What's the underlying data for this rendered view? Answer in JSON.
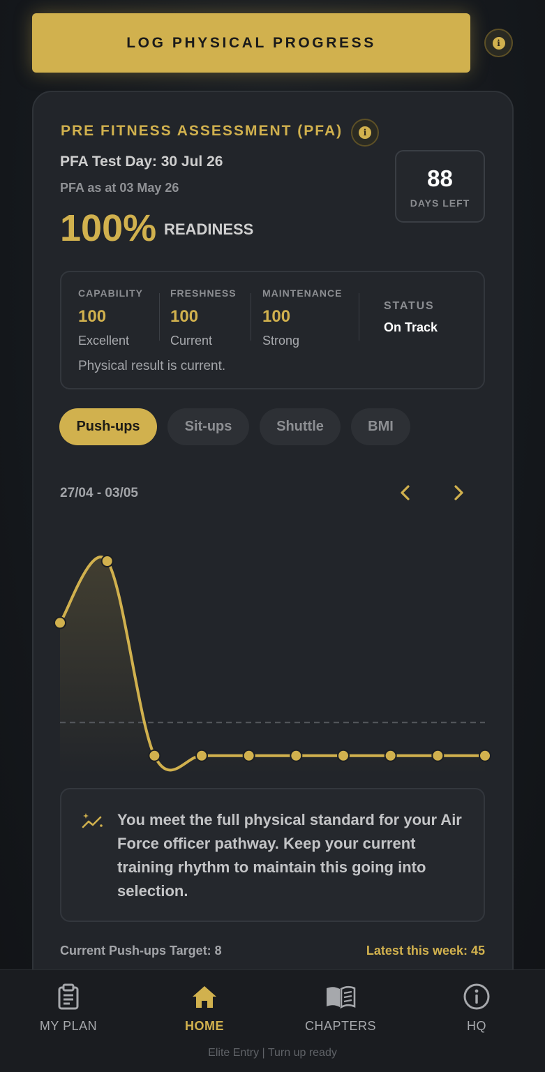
{
  "header": {
    "log_button": "LOG PHYSICAL PROGRESS"
  },
  "pfa": {
    "title": "PRE FITNESS ASSESSMENT (PFA)",
    "test_day": "PFA Test Day: 30 Jul 26",
    "as_at": "PFA as at 03 May 26",
    "readiness_pct": "100%",
    "readiness_label": "READINESS",
    "days_left_value": "88",
    "days_left_label": "DAYS LEFT"
  },
  "metrics": {
    "capability": {
      "label": "CAPABILITY",
      "value": "100",
      "status": "Excellent"
    },
    "freshness": {
      "label": "FRESHNESS",
      "value": "100",
      "status": "Current"
    },
    "maintenance": {
      "label": "MAINTENANCE",
      "value": "100",
      "status": "Strong"
    },
    "status": {
      "label": "STATUS",
      "value": "On Track"
    },
    "note": "Physical result is current."
  },
  "tabs": [
    {
      "label": "Push-ups",
      "active": true
    },
    {
      "label": "Sit-ups",
      "active": false
    },
    {
      "label": "Shuttle",
      "active": false
    },
    {
      "label": "BMI",
      "active": false
    }
  ],
  "chart_nav": {
    "range": "27/04 - 03/05"
  },
  "chart_data": {
    "type": "line",
    "series": [
      {
        "values": [
          64,
          90,
          8,
          8,
          8,
          8,
          8,
          8,
          8,
          8
        ]
      }
    ],
    "target": 22,
    "ylim": [
      0,
      100
    ]
  },
  "insight": {
    "text": "You meet the full physical standard for your Air Force officer pathway. Keep your current training rhythm to maintain this going into selection."
  },
  "footer_stats": {
    "target": "Current Push-ups Target: 8",
    "latest": "Latest this week: 45"
  },
  "nav": {
    "items": [
      {
        "label": "MY PLAN",
        "icon": "clipboard-icon"
      },
      {
        "label": "HOME",
        "icon": "home-icon"
      },
      {
        "label": "CHAPTERS",
        "icon": "book-icon"
      },
      {
        "label": "HQ",
        "icon": "info-icon"
      }
    ],
    "tagline": "Elite Entry | Turn up ready"
  },
  "colors": {
    "accent": "#d1b14e",
    "card": "#22252a",
    "background": "#15181c"
  }
}
